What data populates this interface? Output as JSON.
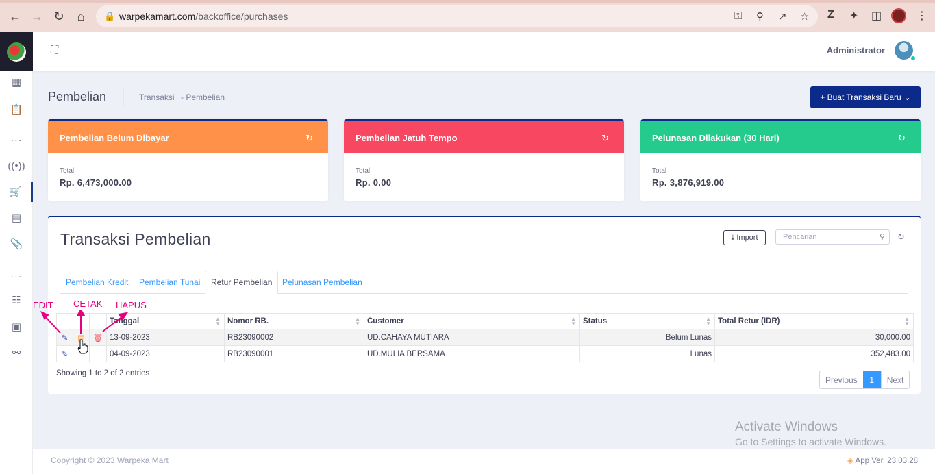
{
  "browser": {
    "url_host": "warpekamart.com",
    "url_path": "/backoffice/purchases"
  },
  "header": {
    "user_name": "Administrator"
  },
  "subheader": {
    "title": "Pembelian",
    "breadcrumb": [
      "Transaksi",
      "- Pembelian"
    ],
    "new_button": "+ Buat Transaksi Baru"
  },
  "cards": [
    {
      "title": "Pembelian Belum Dibayar",
      "label": "Total",
      "value": "Rp. 6,473,000.00",
      "color": "#ff9148"
    },
    {
      "title": "Pembelian Jatuh Tempo",
      "label": "Total",
      "value": "Rp. 0.00",
      "color": "#f84760"
    },
    {
      "title": "Pelunasan Dilakukan (30 Hari)",
      "label": "Total",
      "value": "Rp. 3,876,919.00",
      "color": "#24cb8c"
    }
  ],
  "panel": {
    "title": "Transaksi Pembelian",
    "import_label": "Import",
    "search_placeholder": "Pencarian",
    "tabs": [
      "Pembelian Kredit",
      "Pembelian Tunai",
      "Retur Pembelian",
      "Pelunasan Pembelian"
    ],
    "active_tab": "Retur Pembelian",
    "columns": [
      "Tanggal",
      "Nomor RB.",
      "Customer",
      "Status",
      "Total Retur (IDR)"
    ],
    "rows": [
      {
        "tanggal": "13-09-2023",
        "nomor": "RB23090002",
        "customer": "UD.CAHAYA MUTIARA",
        "status": "Belum Lunas",
        "total": "30,000.00"
      },
      {
        "tanggal": "04-09-2023",
        "nomor": "RB23090001",
        "customer": "UD.MULIA BERSAMA",
        "status": "Lunas",
        "total": "352,483.00"
      }
    ],
    "info": "Showing 1 to 2 of 2 entries",
    "pagination": {
      "previous": "Previous",
      "current": "1",
      "next": "Next"
    }
  },
  "annotations": {
    "edit": "EDIT",
    "cetak": "CETAK",
    "hapus": "HAPUS"
  },
  "watermark": {
    "line1": "Activate Windows",
    "line2": "Go to Settings to activate Windows."
  },
  "footer": {
    "copyright": "Copyright © 2023 Warpeka Mart",
    "version": "App Ver. 23.03.28"
  }
}
